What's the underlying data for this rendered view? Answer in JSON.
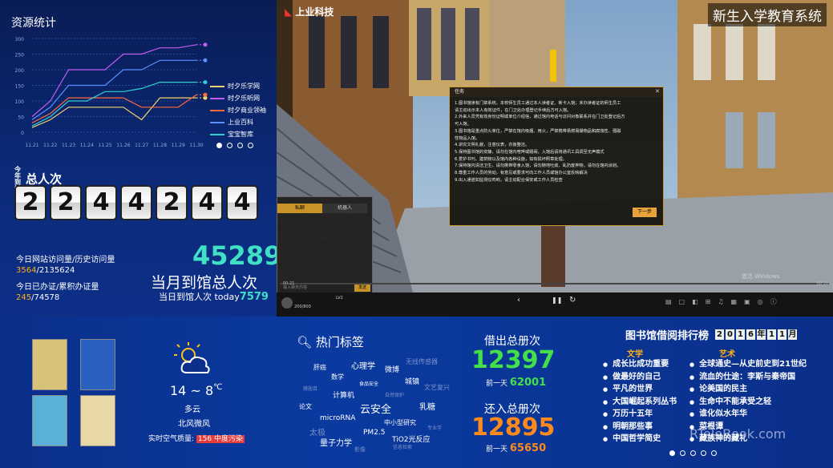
{
  "resources": {
    "title": "资源统计",
    "y_ticks": [
      "0",
      "50",
      "100",
      "150",
      "200",
      "250",
      "300"
    ],
    "legend": [
      "时夕乐学网",
      "时夕乐听网",
      "时夕商业领袖",
      "上业百科",
      "宝宝智库"
    ]
  },
  "chart_data": {
    "type": "line",
    "title": "资源统计",
    "categories": [
      "11.21",
      "11.22",
      "11.23",
      "11.24",
      "11.25",
      "11.26",
      "11.27",
      "11.28",
      "11.29",
      "11.30"
    ],
    "ylim": [
      0,
      300
    ],
    "series": [
      {
        "name": "时夕乐学网",
        "color": "#f2d36b",
        "values": [
          15,
          40,
          80,
          80,
          80,
          80,
          40,
          110,
          110,
          110
        ]
      },
      {
        "name": "时夕乐听网",
        "color": "#c15cf0",
        "values": [
          50,
          100,
          200,
          200,
          200,
          250,
          250,
          270,
          270,
          280
        ]
      },
      {
        "name": "时夕商业领袖",
        "color": "#ff6a3a",
        "values": [
          30,
          60,
          110,
          110,
          110,
          110,
          80,
          80,
          80,
          120
        ]
      },
      {
        "name": "上业百科",
        "color": "#5a8dff",
        "values": [
          40,
          80,
          150,
          150,
          150,
          200,
          200,
          230,
          230,
          230
        ]
      },
      {
        "name": "宝宝智库",
        "color": "#30d0d0",
        "values": [
          20,
          50,
          100,
          100,
          130,
          130,
          140,
          160,
          160,
          160
        ]
      }
    ]
  },
  "visitors": {
    "label_small": "今年到馆",
    "label": "总人次",
    "digits": [
      "2",
      "2",
      "4",
      "4",
      "2",
      "4",
      "4"
    ],
    "site_visits_label": "今日网站访问量/历史访问量",
    "site_visits_today": "3564",
    "site_visits_total": "/2135624",
    "cards_label": "今日已办证/累积办证量",
    "cards_today": "245",
    "cards_total": "/74578",
    "month_total": "45289",
    "month_label": "当月到馆总人次",
    "today_label": "当日到馆人次 today",
    "today_value": "7579"
  },
  "video": {
    "title": "新生入学教育系统",
    "logo": "上业科技",
    "dialog_title": "任务",
    "dialog_lines": [
      "1.图书馆读有门禁系统，本校师生员工通过本人读者证、新卡入馆；未办读者证的师生员工",
      "请主动出示本人有效证件，在门卫处办理登记手续后方可入馆。",
      "2.外来人员凭有效身份证明或单位介绍信，通过馆内电话与访问对象联系并在门卫处登记后方",
      "可入馆。",
      "3.图书馆是重点防火单位，严禁在馆内吸烟、用火，严禁携带易燃易爆物品和腐蚀性、强磁",
      "性物品入馆。",
      "4.讲究文明礼貌，注意仪表，衣装整洁。",
      "5.保持图书馆的安静，请勿在馆内喧哗或嬉闹，入馆后请将通讯工具调至无声模式",
      "6.爱护书刊、建筑物以及馆内各种设施，如有损坏照章处理。",
      "7.保持馆内清洁卫生，请勿携带零食入馆，请勿随地吐痰、乱扔废弃物，请勿在馆内涂划。",
      "8.尊重工作人员的劳动，有意见或要求可向工作人员或馆办公室反映解决",
      "9.出入通道如监测仪鸣响，请主动配合保安或工作人员检查"
    ],
    "dialog_next": "下一步",
    "chat_tabs": [
      "私聊",
      "机器人"
    ],
    "chat_placeholder": "输入聊天内容",
    "chat_send": "发送",
    "watermark_win": "激活 Windows",
    "time_left": "00:21",
    "time_right": "00:19",
    "level": "LV2",
    "score": "200/800"
  },
  "weather": {
    "temp": "14 ~ 8",
    "unit": "℃",
    "condition": "多云",
    "wind": "北风微风",
    "aqi_label": "实时空气质量:",
    "aqi_value": "156 中度污染"
  },
  "tags": {
    "title": "热门标签",
    "items": [
      "心理学",
      "无线传感器",
      "肝癌",
      "微博",
      "数学",
      "食品安全",
      "城镇",
      "文艺复兴",
      "膜翅目",
      "计算机",
      "自然保护",
      "论文",
      "云安全",
      "乳糖",
      "microRNA",
      "中小型研究",
      "专业学",
      "太极",
      "量子力学",
      "PM2.5",
      "TiO2光反应",
      "影像",
      "信息检索"
    ]
  },
  "borrow": {
    "title": "借出总册次",
    "value": "12397",
    "prev_label": "前一天",
    "prev_value": "62001"
  },
  "return": {
    "title": "还入总册次",
    "value": "12895",
    "prev_label": "前一天",
    "prev_value": "65650"
  },
  "ranking": {
    "title": "图书馆借阅排行榜",
    "date_chars": [
      "2",
      "0",
      "1",
      "6",
      "年",
      "1",
      "1",
      "月"
    ],
    "cat_lit": "文学",
    "cat_art": "艺术",
    "lit_items": [
      "成长比成功重要",
      "做最好的自己",
      "平凡的世界",
      "大国崛起系列丛书",
      "万历十五年",
      "明朝那些事",
      "中国哲学简史"
    ],
    "art_items": [
      "全球通史—从史前史到21世纪",
      "流血的仕途：李斯与秦帝国",
      "论美国的民主",
      "生命中不能承受之轻",
      "谁化似水年华",
      "菜根谭",
      "藏族神的藏礼"
    ]
  },
  "watermark": "RTeleBook.com"
}
